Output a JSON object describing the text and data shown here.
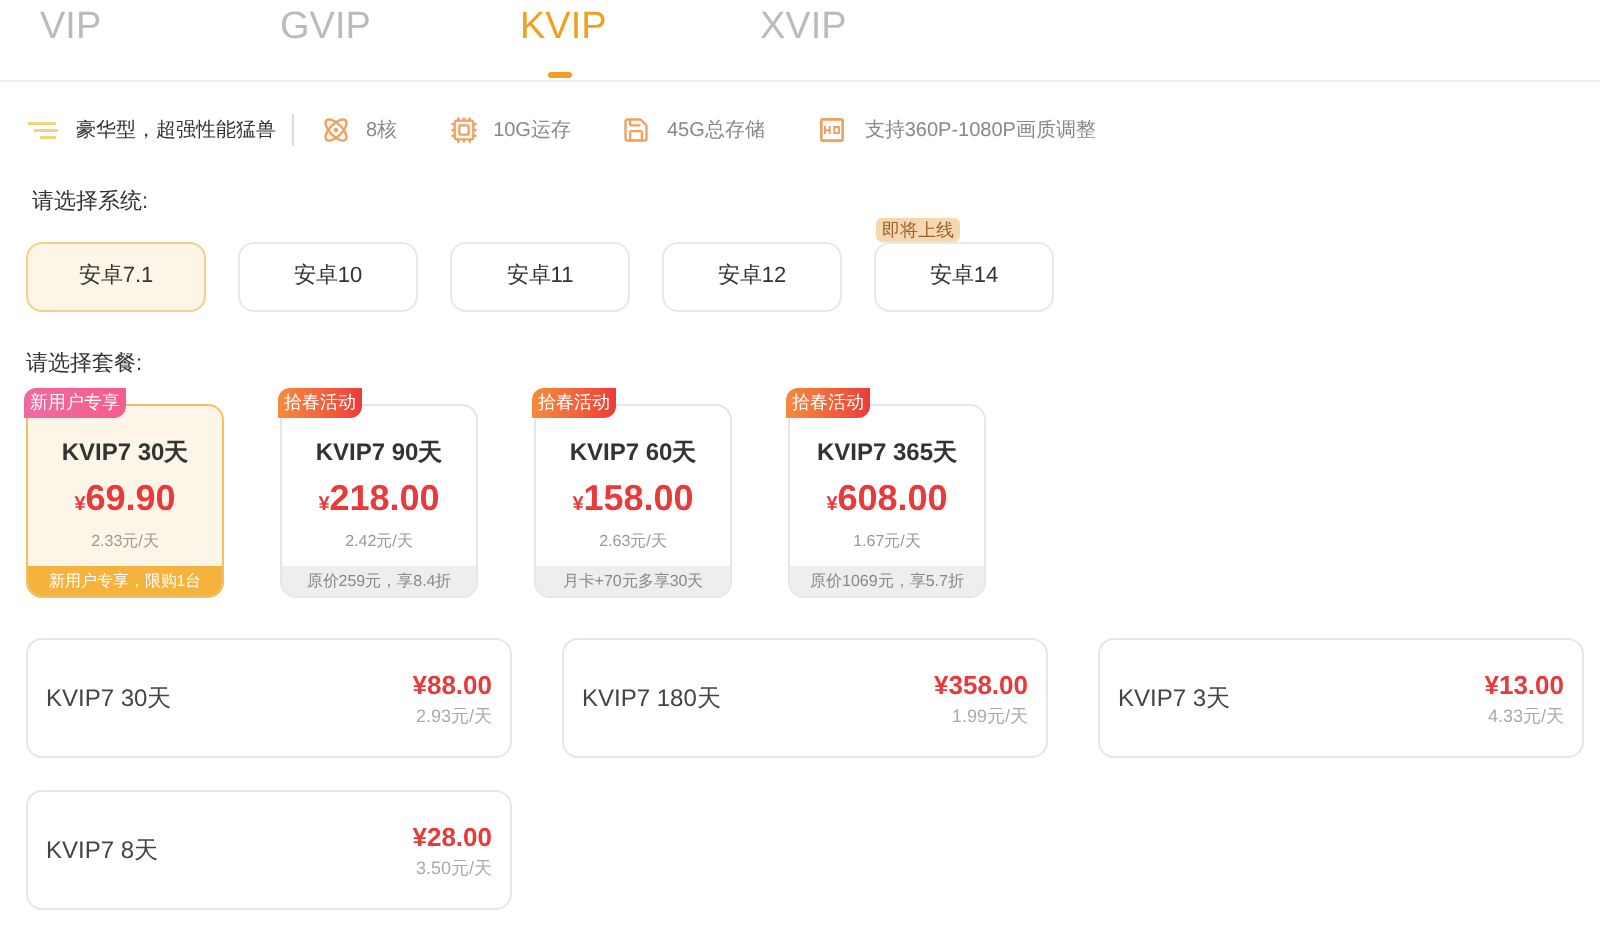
{
  "tabs": [
    {
      "label": "VIP",
      "selected": false
    },
    {
      "label": "GVIP",
      "selected": false
    },
    {
      "label": "KVIP",
      "selected": true
    },
    {
      "label": "XVIP",
      "selected": false
    }
  ],
  "features": {
    "tagline": "豪华型，超强性能猛兽",
    "items": [
      {
        "kind": "cores",
        "label": "8核"
      },
      {
        "kind": "ram",
        "label": "10G运存"
      },
      {
        "kind": "storage",
        "label": "45G总存储"
      },
      {
        "kind": "hd",
        "label": "支持360P-1080P画质调整"
      }
    ]
  },
  "system_label": "请选择系统:",
  "systems": [
    {
      "label": "安卓7.1",
      "selected": true
    },
    {
      "label": "安卓10",
      "selected": false
    },
    {
      "label": "安卓11",
      "selected": false
    },
    {
      "label": "安卓12",
      "selected": false
    },
    {
      "label": "安卓14",
      "selected": false,
      "badge": "即将上线"
    }
  ],
  "package_label": "请选择套餐:",
  "packages": [
    {
      "badge": "新用户专享",
      "kind": "new",
      "name": "KVIP7 30天",
      "currency": "¥",
      "price": "69.90",
      "per_day": "2.33元/天",
      "note": "新用户专享，限购1台",
      "selected": true
    },
    {
      "badge": "拾春活动",
      "kind": "promo",
      "name": "KVIP7 90天",
      "currency": "¥",
      "price": "218.00",
      "per_day": "2.42元/天",
      "note": "原价259元，享8.4折",
      "selected": false
    },
    {
      "badge": "拾春活动",
      "kind": "promo",
      "name": "KVIP7 60天",
      "currency": "¥",
      "price": "158.00",
      "per_day": "2.63元/天",
      "note": "月卡+70元多享30天",
      "selected": false
    },
    {
      "badge": "拾春活动",
      "kind": "promo",
      "name": "KVIP7 365天",
      "currency": "¥",
      "price": "608.00",
      "per_day": "1.67元/天",
      "note": "原价1069元，享5.7折",
      "selected": false
    }
  ],
  "plans": [
    {
      "name": "KVIP7 30天",
      "price": "¥88.00",
      "per_day": "2.93元/天"
    },
    {
      "name": "KVIP7 180天",
      "price": "¥358.00",
      "per_day": "1.99元/天"
    },
    {
      "name": "KVIP7 3天",
      "price": "¥13.00",
      "per_day": "4.33元/天"
    },
    {
      "name": "KVIP7 8天",
      "price": "¥28.00",
      "per_day": "3.50元/天"
    }
  ]
}
